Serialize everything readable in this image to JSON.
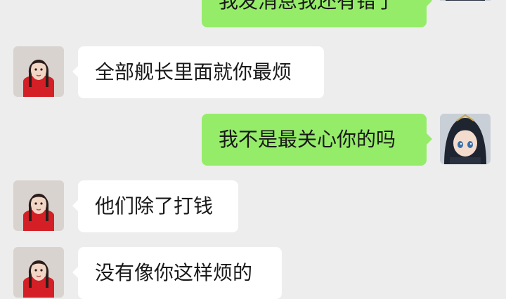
{
  "colors": {
    "background": "#ededed",
    "incoming_bubble": "#ffffff",
    "outgoing_bubble": "#95ec69",
    "text": "#191919"
  },
  "messages": [
    {
      "side": "out",
      "text": "我发消息我还有错了"
    },
    {
      "side": "in",
      "text": "全部舰长里面就你最烦"
    },
    {
      "side": "out",
      "text": "我不是最关心你的吗"
    },
    {
      "side": "in",
      "text": "他们除了打钱"
    },
    {
      "side": "in",
      "text": "没有像你这样烦的"
    }
  ],
  "avatars": {
    "contact": "contact-avatar-girl-red-top",
    "self": "self-avatar-anime-dark-hair"
  }
}
